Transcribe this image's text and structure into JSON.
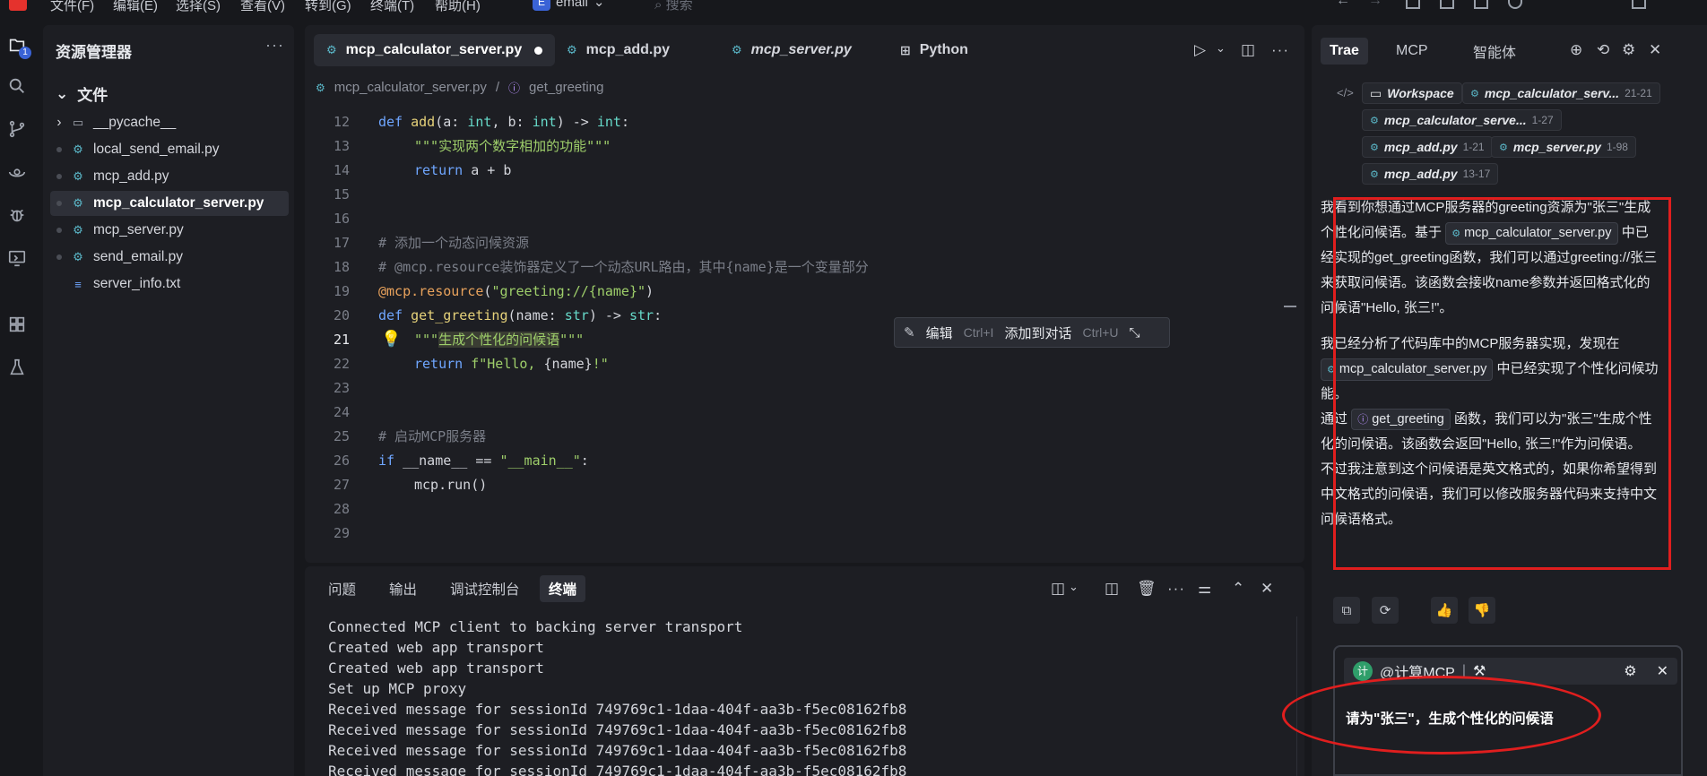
{
  "menubar": {
    "items": [
      "文件(F)",
      "编辑(E)",
      "选择(S)",
      "查看(V)",
      "转到(G)",
      "终端(T)",
      "帮助(H)"
    ],
    "project_badge": "E",
    "project_name": "email",
    "search_placeholder": "搜索"
  },
  "activity": {
    "explorer_badge": "1",
    "icons": [
      "explorer-icon",
      "search-icon",
      "source-control-icon",
      "remote-icon",
      "debug-icon",
      "remote-explorer-icon",
      "extensions-icon",
      "testing-icon"
    ]
  },
  "explorer": {
    "title": "资源管理器",
    "more": "···",
    "section": "文件",
    "files": [
      {
        "name": "__pycache__",
        "type": "folder"
      },
      {
        "name": "local_send_email.py",
        "type": "py"
      },
      {
        "name": "mcp_add.py",
        "type": "py"
      },
      {
        "name": "mcp_calculator_server.py",
        "type": "py",
        "active": true
      },
      {
        "name": "mcp_server.py",
        "type": "py"
      },
      {
        "name": "send_email.py",
        "type": "py"
      },
      {
        "name": "server_info.txt",
        "type": "txt"
      }
    ]
  },
  "editor": {
    "tabs": [
      {
        "label": "mcp_calculator_server.py",
        "active": true,
        "dirty": true
      },
      {
        "label": "mcp_add.py"
      },
      {
        "label": "mcp_server.py"
      },
      {
        "label": "Python"
      }
    ],
    "breadcrumb": [
      "mcp_calculator_server.py",
      "/",
      "get_greeting"
    ],
    "lines": [
      {
        "n": "12"
      },
      {
        "n": "13"
      },
      {
        "n": "14"
      },
      {
        "n": "15"
      },
      {
        "n": "16"
      },
      {
        "n": "17"
      },
      {
        "n": "18"
      },
      {
        "n": "19"
      },
      {
        "n": "20"
      },
      {
        "n": "21"
      },
      {
        "n": "22"
      },
      {
        "n": "23"
      },
      {
        "n": "24"
      },
      {
        "n": "25"
      },
      {
        "n": "26"
      },
      {
        "n": "27"
      },
      {
        "n": "28"
      },
      {
        "n": "29"
      }
    ],
    "code": {
      "l12_def": "def",
      "l12_fn": "add",
      "l12_a": "(a: ",
      "l12_int1": "int",
      "l12_b": ", b: ",
      "l12_int2": "int",
      "l12_arrow": ") -> ",
      "l12_int3": "int",
      "l12_colon": ":",
      "l13": "\"\"\"实现两个数字相加的功能\"\"\"",
      "l14_ret": "return",
      "l14_rest": " a + b",
      "l17": "# 添加一个动态问候资源",
      "l18": "# @mcp.resource装饰器定义了一个动态URL路由，其中{name}是一个变量部分",
      "l19_deco": "@mcp.resource",
      "l19_p": "(",
      "l19_str": "\"greeting://{name}\"",
      "l19_end": ")",
      "l20_def": "def",
      "l20_fn": "get_greeting",
      "l20_a": "(name: ",
      "l20_ty": "str",
      "l20_arrow": ") -> ",
      "l20_ty2": "str",
      "l20_colon": ":",
      "l21_q1": "\"\"\"",
      "l21_hl": "生成个性化的问候语",
      "l21_q2": "\"\"\"",
      "l22_ret": "return",
      "l22_str": " f\"Hello, ",
      "l22_var": "{name}",
      "l22_end": "!\"",
      "l25": "# 启动MCP服务器",
      "l26_if": "if",
      "l26_mid": " __name__ == ",
      "l26_str": "\"__main__\"",
      "l26_colon": ":",
      "l27": "mcp.run()"
    },
    "popup": {
      "edit": "编辑",
      "edit_key": "Ctrl+I",
      "add": "添加到对话",
      "add_key": "Ctrl+U"
    }
  },
  "panel": {
    "tabs": [
      "问题",
      "输出",
      "调试控制台",
      "终端"
    ],
    "active_tab": "终端",
    "terminal_lines": [
      "Connected MCP client to backing server transport",
      "Created web app transport",
      "Created web app transport",
      "Set up MCP proxy",
      "Received message for sessionId 749769c1-1daa-404f-aa3b-f5ec08162fb8",
      "Received message for sessionId 749769c1-1daa-404f-aa3b-f5ec08162fb8",
      "Received message for sessionId 749769c1-1daa-404f-aa3b-f5ec08162fb8",
      "Received message for sessionId 749769c1-1daa-404f-aa3b-f5ec08162fb8"
    ]
  },
  "chat": {
    "tabs": [
      "Trae",
      "MCP",
      "智能体"
    ],
    "refs": [
      {
        "label": "Workspace",
        "range": ""
      },
      {
        "label": "mcp_calculator_serv...",
        "range": "21-21"
      },
      {
        "label": "mcp_calculator_serve...",
        "range": "1-27"
      },
      {
        "label": "mcp_add.py",
        "range": "1-21"
      },
      {
        "label": "mcp_server.py",
        "range": "1-98"
      },
      {
        "label": "mcp_add.py",
        "range": "13-17"
      }
    ],
    "body": {
      "p1a": "我看到你想通过MCP服务器的greeting资源为\"张三\"生成个性化问候语。基于",
      "chip1": "mcp_calculator_server.py",
      "p1b": "中已经实现的get_greeting函数，我们可以通过greeting://张三来获取问候语。该函数会接收name参数并返回格式化的问候语\"Hello, 张三!\"。",
      "p2a": "我已经分析了代码库中的MCP服务器实现，发现在",
      "chip2": "mcp_calculator_server.py",
      "p2b": "中已经实现了个性化问候功能。",
      "p3a": "通过",
      "chip3": "get_greeting",
      "p3b": "函数，我们可以为\"张三\"生成个性化的问候语。该函数会返回\"Hello, 张三!\"作为问候语。",
      "p4": "不过我注意到这个问候语是英文格式的，如果你希望得到中文格式的问候语，我们可以修改服务器代码来支持中文问候语格式。"
    },
    "input": {
      "agent_avatar": "计",
      "agent_name": "@计算MCP",
      "query": "请为\"张三\"，生成个性化的问候语"
    }
  },
  "colors": {
    "accent": "#3a63d6",
    "annotation_red": "#e01e1e",
    "python_icon": "#5bb8c9"
  }
}
